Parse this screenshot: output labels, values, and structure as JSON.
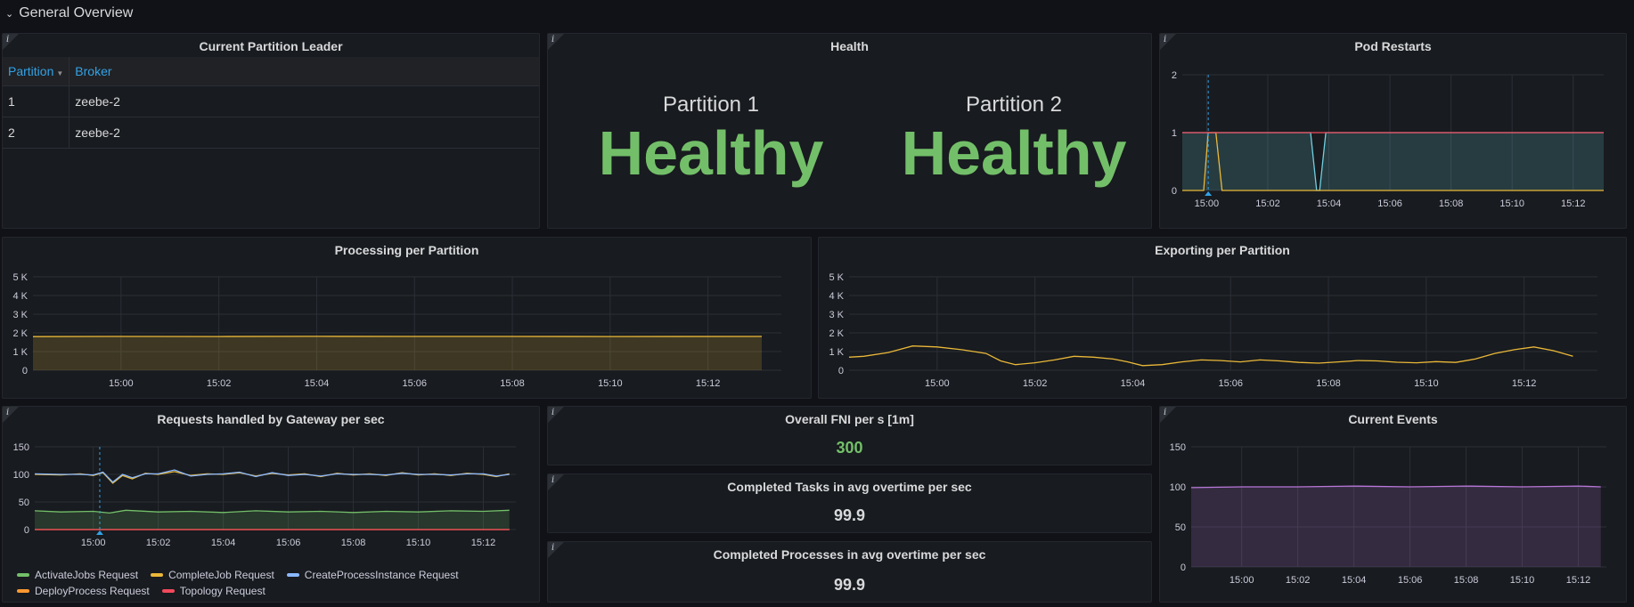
{
  "row": {
    "title": "General Overview",
    "chevron": "⌄"
  },
  "info_glyph": "i",
  "leader": {
    "title": "Current Partition Leader",
    "columns": [
      "Partition",
      "Broker"
    ],
    "rows": [
      [
        "1",
        "zeebe-2"
      ],
      [
        "2",
        "zeebe-2"
      ]
    ]
  },
  "health": {
    "title": "Health",
    "items": [
      {
        "label": "Partition 1",
        "value": "Healthy"
      },
      {
        "label": "Partition 2",
        "value": "Healthy"
      }
    ],
    "color": "#73bf69"
  },
  "fni": {
    "title": "Overall FNI per s [1m]",
    "value": "300",
    "color": "#73bf69"
  },
  "tasks": {
    "title": "Completed Tasks in avg overtime per sec",
    "value": "99.9",
    "color": "#d8d9da"
  },
  "processes": {
    "title": "Completed Processes in avg overtime per sec",
    "value": "99.9",
    "color": "#d8d9da"
  },
  "chart_data": [
    {
      "id": "pod-restarts",
      "title": "Pod Restarts",
      "type": "area",
      "x_ticks": [
        "15:00",
        "15:02",
        "15:04",
        "15:06",
        "15:08",
        "15:10",
        "15:12"
      ],
      "xlim": [
        -0.8,
        13.0
      ],
      "y_ticks": [
        "0",
        "1",
        "2"
      ],
      "ylim": [
        0,
        2
      ],
      "grid": true,
      "series": [
        {
          "color": "#6ed0e0",
          "fill": true,
          "points": [
            [
              -0.8,
              1
            ],
            [
              0,
              1
            ],
            [
              3.4,
              1
            ],
            [
              3.6,
              0
            ],
            [
              3.7,
              0
            ],
            [
              3.9,
              1
            ],
            [
              13,
              1
            ]
          ]
        },
        {
          "color": "#eab839",
          "fill": false,
          "points": [
            [
              -0.8,
              0
            ],
            [
              -0.1,
              0
            ],
            [
              0.05,
              1
            ],
            [
              0.3,
              1
            ],
            [
              0.5,
              0
            ],
            [
              13,
              0
            ]
          ]
        },
        {
          "color": "#f2495c",
          "fill": false,
          "points": [
            [
              -0.8,
              1
            ],
            [
              13,
              1
            ]
          ]
        }
      ]
    },
    {
      "id": "processing",
      "title": "Processing per Partition",
      "type": "area",
      "x_ticks": [
        "15:00",
        "15:02",
        "15:04",
        "15:06",
        "15:08",
        "15:10",
        "15:12"
      ],
      "xlim": [
        -1.8,
        13.5
      ],
      "y_ticks": [
        "0",
        "1 K",
        "2 K",
        "3 K",
        "4 K",
        "5 K"
      ],
      "ylim": [
        0,
        5000
      ],
      "grid": true,
      "series": [
        {
          "color": "#eab839",
          "fill": true,
          "points": [
            [
              -1.8,
              1800
            ],
            [
              0,
              1810
            ],
            [
              2,
              1805
            ],
            [
              4,
              1812
            ],
            [
              6,
              1808
            ],
            [
              8,
              1810
            ],
            [
              10,
              1806
            ],
            [
              13.1,
              1810
            ]
          ]
        }
      ]
    },
    {
      "id": "exporting",
      "title": "Exporting per Partition",
      "type": "line",
      "x_ticks": [
        "15:00",
        "15:02",
        "15:04",
        "15:06",
        "15:08",
        "15:10",
        "15:12"
      ],
      "xlim": [
        -1.8,
        13.5
      ],
      "y_ticks": [
        "0",
        "1 K",
        "2 K",
        "3 K",
        "4 K",
        "5 K"
      ],
      "ylim": [
        0,
        5000
      ],
      "grid": true,
      "series": [
        {
          "color": "#eab839",
          "fill": false,
          "points": [
            [
              -1.8,
              700
            ],
            [
              -1.5,
              750
            ],
            [
              -1,
              950
            ],
            [
              -0.5,
              1300
            ],
            [
              0,
              1250
            ],
            [
              0.5,
              1100
            ],
            [
              1,
              900
            ],
            [
              1.3,
              500
            ],
            [
              1.6,
              300
            ],
            [
              2,
              400
            ],
            [
              2.4,
              550
            ],
            [
              2.8,
              750
            ],
            [
              3.2,
              700
            ],
            [
              3.6,
              600
            ],
            [
              3.9,
              450
            ],
            [
              4.2,
              250
            ],
            [
              4.6,
              300
            ],
            [
              5,
              450
            ],
            [
              5.4,
              550
            ],
            [
              5.8,
              520
            ],
            [
              6.2,
              450
            ],
            [
              6.6,
              550
            ],
            [
              7,
              500
            ],
            [
              7.4,
              420
            ],
            [
              7.8,
              380
            ],
            [
              8.2,
              450
            ],
            [
              8.6,
              520
            ],
            [
              9,
              500
            ],
            [
              9.4,
              430
            ],
            [
              9.8,
              400
            ],
            [
              10.2,
              460
            ],
            [
              10.6,
              420
            ],
            [
              11,
              600
            ],
            [
              11.4,
              900
            ],
            [
              11.8,
              1100
            ],
            [
              12.2,
              1250
            ],
            [
              12.6,
              1050
            ],
            [
              13,
              750
            ]
          ]
        }
      ]
    },
    {
      "id": "gateway",
      "title": "Requests handled by Gateway per sec",
      "type": "line",
      "x_ticks": [
        "15:00",
        "15:02",
        "15:04",
        "15:06",
        "15:08",
        "15:10",
        "15:12"
      ],
      "xlim": [
        -1.8,
        13.0
      ],
      "y_ticks": [
        "0",
        "50",
        "100",
        "150"
      ],
      "ylim": [
        0,
        150
      ],
      "grid": true,
      "series": [
        {
          "name": "ActivateJobs Request",
          "color": "#73bf69",
          "fill": true,
          "points": [
            [
              -1.8,
              34
            ],
            [
              -1,
              32
            ],
            [
              0,
              33
            ],
            [
              0.5,
              30
            ],
            [
              1,
              35
            ],
            [
              2,
              32
            ],
            [
              3,
              33
            ],
            [
              4,
              31
            ],
            [
              5,
              34
            ],
            [
              6,
              32
            ],
            [
              7,
              33
            ],
            [
              8,
              31
            ],
            [
              9,
              33
            ],
            [
              10,
              32
            ],
            [
              11,
              34
            ],
            [
              12,
              33
            ],
            [
              12.8,
              35
            ]
          ]
        },
        {
          "name": "CompleteJob Request",
          "color": "#eab839",
          "fill": false,
          "points": [
            [
              -1.8,
              100
            ],
            [
              -1,
              99
            ],
            [
              -0.4,
              101
            ],
            [
              0,
              98
            ],
            [
              0.3,
              103
            ],
            [
              0.6,
              84
            ],
            [
              0.9,
              98
            ],
            [
              1.2,
              92
            ],
            [
              1.6,
              102
            ],
            [
              2,
              100
            ],
            [
              2.5,
              105
            ],
            [
              3,
              98
            ],
            [
              3.5,
              101
            ],
            [
              4,
              100
            ],
            [
              4.5,
              103
            ],
            [
              5,
              97
            ],
            [
              5.5,
              102
            ],
            [
              6,
              99
            ],
            [
              6.5,
              101
            ],
            [
              7,
              96
            ],
            [
              7.5,
              102
            ],
            [
              8,
              99
            ],
            [
              8.5,
              101
            ],
            [
              9,
              98
            ],
            [
              9.5,
              103
            ],
            [
              10,
              99
            ],
            [
              10.5,
              101
            ],
            [
              11,
              98
            ],
            [
              11.5,
              102
            ],
            [
              12,
              100
            ],
            [
              12.4,
              96
            ],
            [
              12.8,
              101
            ]
          ]
        },
        {
          "name": "CreateProcessInstance Request",
          "color": "#8ab8ff",
          "fill": false,
          "points": [
            [
              -1.8,
              101
            ],
            [
              -1,
              100
            ],
            [
              -0.4,
              100
            ],
            [
              0,
              99
            ],
            [
              0.3,
              104
            ],
            [
              0.6,
              86
            ],
            [
              0.9,
              100
            ],
            [
              1.2,
              94
            ],
            [
              1.6,
              101
            ],
            [
              2,
              101
            ],
            [
              2.5,
              108
            ],
            [
              3,
              97
            ],
            [
              3.5,
              100
            ],
            [
              4,
              101
            ],
            [
              4.5,
              104
            ],
            [
              5,
              96
            ],
            [
              5.5,
              103
            ],
            [
              6,
              98
            ],
            [
              6.5,
              100
            ],
            [
              7,
              97
            ],
            [
              7.5,
              101
            ],
            [
              8,
              100
            ],
            [
              8.5,
              100
            ],
            [
              9,
              99
            ],
            [
              9.5,
              102
            ],
            [
              10,
              100
            ],
            [
              10.5,
              100
            ],
            [
              11,
              99
            ],
            [
              11.5,
              101
            ],
            [
              12,
              101
            ],
            [
              12.4,
              97
            ],
            [
              12.8,
              100
            ]
          ]
        },
        {
          "name": "DeployProcess Request",
          "color": "#ff9830",
          "fill": false,
          "points": [
            [
              -1.8,
              0
            ],
            [
              12.8,
              0
            ]
          ]
        },
        {
          "name": "Topology Request",
          "color": "#f2495c",
          "fill": false,
          "points": [
            [
              -1.8,
              0
            ],
            [
              12.8,
              0
            ]
          ]
        }
      ]
    },
    {
      "id": "events",
      "title": "Current Events",
      "type": "area",
      "x_ticks": [
        "15:00",
        "15:02",
        "15:04",
        "15:06",
        "15:08",
        "15:10",
        "15:12"
      ],
      "xlim": [
        -1.8,
        13.0
      ],
      "y_ticks": [
        "0",
        "50",
        "100",
        "150"
      ],
      "ylim": [
        0,
        150
      ],
      "grid": true,
      "series": [
        {
          "color": "#b877d9",
          "fill": true,
          "points": [
            [
              -1.8,
              99
            ],
            [
              0,
              100
            ],
            [
              2,
              100
            ],
            [
              4,
              101
            ],
            [
              6,
              100
            ],
            [
              8,
              101
            ],
            [
              10,
              100
            ],
            [
              12,
              101
            ],
            [
              12.8,
              100
            ]
          ]
        }
      ]
    }
  ]
}
